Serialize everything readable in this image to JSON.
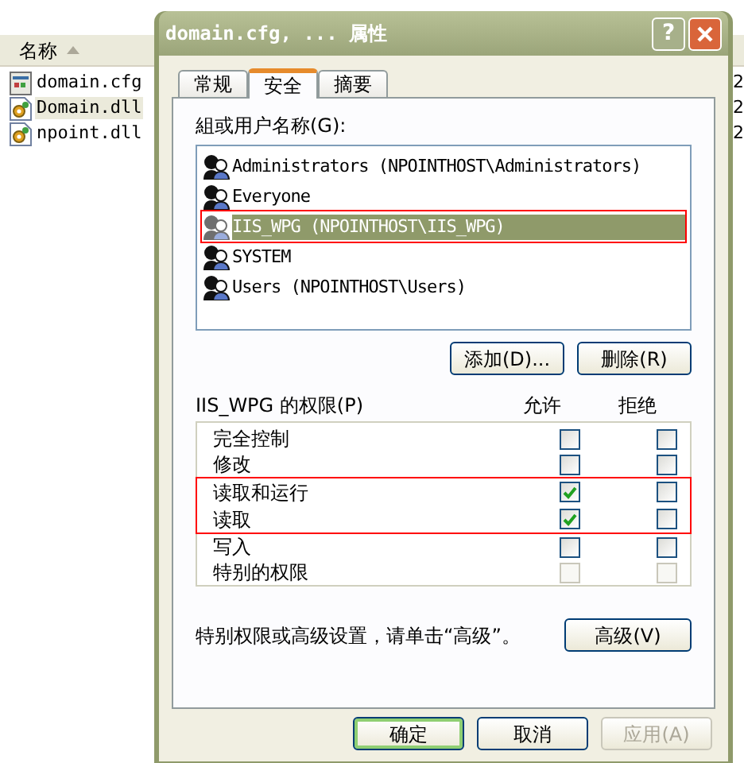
{
  "explorer": {
    "column": "名称",
    "files": [
      {
        "name": "domain.cfg",
        "kind": "cfg",
        "selected": false
      },
      {
        "name": "Domain.dll",
        "kind": "dll",
        "selected": true
      },
      {
        "name": "npoint.dll",
        "kind": "dll",
        "selected": false
      }
    ],
    "column_2": [
      "2",
      "2",
      "2"
    ]
  },
  "dialog": {
    "title": "domain.cfg, ... 属性",
    "help": "?",
    "tabs": [
      {
        "label": "常规",
        "selected": false
      },
      {
        "label": "安全",
        "selected": true
      },
      {
        "label": "摘要",
        "selected": false
      }
    ],
    "group_label": "組或用户名称(G):",
    "users": [
      {
        "name": "Administrators (NPOINTHOST\\Administrators)",
        "selected": false,
        "highlighted": false
      },
      {
        "name": "Everyone",
        "selected": false,
        "highlighted": false
      },
      {
        "name": "IIS_WPG (NPOINTHOST\\IIS_WPG)",
        "selected": true,
        "highlighted": true
      },
      {
        "name": "SYSTEM",
        "selected": false,
        "highlighted": false
      },
      {
        "name": "Users (NPOINTHOST\\Users)",
        "selected": false,
        "highlighted": false
      }
    ],
    "buttons": [
      "添加(D)...",
      "删除(R)"
    ],
    "permissions_label": "IIS_WPG 的权限(P)",
    "columns": [
      "允许",
      "拒绝"
    ],
    "permissions": [
      {
        "name": "完全控制",
        "allow": {
          "checked": false,
          "disabled": false
        },
        "deny": {
          "checked": false,
          "disabled": false
        },
        "highlighted": false
      },
      {
        "name": "修改",
        "allow": {
          "checked": false,
          "disabled": false
        },
        "deny": {
          "checked": false,
          "disabled": false
        },
        "highlighted": false
      },
      {
        "name": "读取和运行",
        "allow": {
          "checked": true,
          "disabled": false
        },
        "deny": {
          "checked": false,
          "disabled": false
        },
        "highlighted": true
      },
      {
        "name": "读取",
        "allow": {
          "checked": true,
          "disabled": false
        },
        "deny": {
          "checked": false,
          "disabled": false
        },
        "highlighted": true
      },
      {
        "name": "写入",
        "allow": {
          "checked": false,
          "disabled": false
        },
        "deny": {
          "checked": false,
          "disabled": false
        },
        "highlighted": false
      },
      {
        "name": "特别的权限",
        "allow": {
          "checked": false,
          "disabled": true
        },
        "deny": {
          "checked": false,
          "disabled": true
        },
        "highlighted": false
      }
    ],
    "note": "特别权限或高级设置，请单击“高级”。",
    "advanced_button": "高级(V)",
    "footer_buttons": [
      {
        "label": "确定",
        "default": true,
        "disabled": false
      },
      {
        "label": "取消",
        "default": false,
        "disabled": false
      },
      {
        "label": "应用(A)",
        "default": false,
        "disabled": true
      }
    ]
  }
}
